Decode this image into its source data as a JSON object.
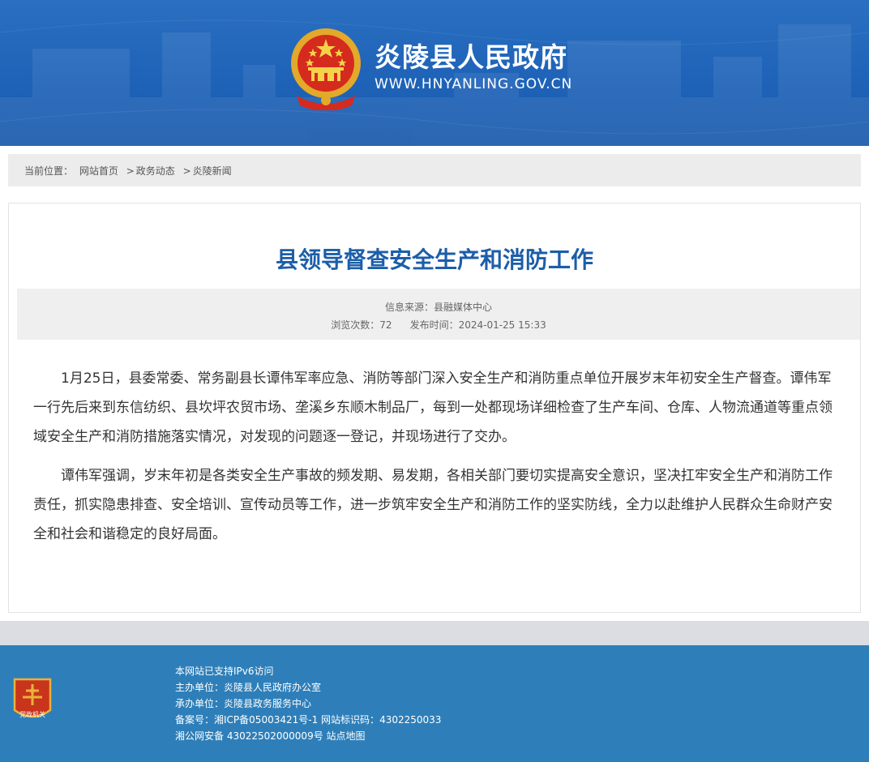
{
  "header": {
    "site_name": "炎陵县人民政府",
    "site_domain": "WWW.HNYANLING.GOV.CN",
    "emblem_icon": "national-emblem-icon"
  },
  "breadcrumb": {
    "label": "当前位置：",
    "items": [
      "网站首页",
      "政务动态",
      "炎陵新闻"
    ],
    "separator": ">"
  },
  "article": {
    "title": "县领导督查安全生产和消防工作",
    "source_label": "信息来源：",
    "source_value": "县融媒体中心",
    "views_label": "浏览次数：",
    "views_value": "72",
    "published_label": "发布时间：",
    "published_value": "2024-01-25 15:33",
    "paragraphs": [
      "1月25日，县委常委、常务副县长谭伟军率应急、消防等部门深入安全生产和消防重点单位开展岁末年初安全生产督查。谭伟军一行先后来到东信纺织、县坎坪农贸市场、垄溪乡东顺木制品厂，每到一处都现场详细检查了生产车间、仓库、人物流通道等重点领域安全生产和消防措施落实情况，对发现的问题逐一登记，并现场进行了交办。",
      "谭伟军强调，岁末年初是各类安全生产事故的频发期、易发期，各相关部门要切实提高安全意识，坚决扛牢安全生产和消防工作责任，抓实隐患排查、安全培训、宣传动员等工作，进一步筑牢安全生产和消防工作的坚实防线，全力以赴维护人民群众生命财产安全和社会和谐稳定的良好局面。"
    ]
  },
  "footer": {
    "badge_text": "党政机关",
    "ipv6": "本网站已支持IPv6访问",
    "sponsor_label": "主办单位：",
    "sponsor": "炎陵县人民政府办公室",
    "organizer_label": "承办单位：",
    "organizer": "炎陵县政务服务中心",
    "icp_label": "备案号：",
    "icp": "湘ICP备05003421号-1",
    "site_id_label": "网站标识码：",
    "site_id": "4302250033",
    "police": "湘公网安备 43022502000009号",
    "sitemap": "站点地图"
  },
  "colors": {
    "banner_blue": "#1e63b8",
    "title_blue": "#1c5ea8",
    "footer_blue": "#2e7fb9",
    "band_grey": "#dcdde3"
  }
}
